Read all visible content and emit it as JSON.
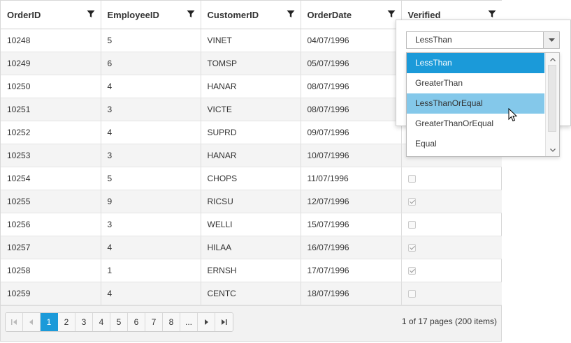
{
  "grid": {
    "columns": [
      {
        "label": "OrderID",
        "key": "order_id"
      },
      {
        "label": "EmployeeID",
        "key": "employee_id"
      },
      {
        "label": "CustomerID",
        "key": "customer_id"
      },
      {
        "label": "OrderDate",
        "key": "order_date"
      },
      {
        "label": "Verified",
        "key": "verified"
      }
    ],
    "rows": [
      {
        "order_id": "10248",
        "employee_id": "5",
        "customer_id": "VINET",
        "order_date": "04/07/1996",
        "verified": null
      },
      {
        "order_id": "10249",
        "employee_id": "6",
        "customer_id": "TOMSP",
        "order_date": "05/07/1996",
        "verified": null
      },
      {
        "order_id": "10250",
        "employee_id": "4",
        "customer_id": "HANAR",
        "order_date": "08/07/1996",
        "verified": null
      },
      {
        "order_id": "10251",
        "employee_id": "3",
        "customer_id": "VICTE",
        "order_date": "08/07/1996",
        "verified": null
      },
      {
        "order_id": "10252",
        "employee_id": "4",
        "customer_id": "SUPRD",
        "order_date": "09/07/1996",
        "verified": null
      },
      {
        "order_id": "10253",
        "employee_id": "3",
        "customer_id": "HANAR",
        "order_date": "10/07/1996",
        "verified": null
      },
      {
        "order_id": "10254",
        "employee_id": "5",
        "customer_id": "CHOPS",
        "order_date": "11/07/1996",
        "verified": false
      },
      {
        "order_id": "10255",
        "employee_id": "9",
        "customer_id": "RICSU",
        "order_date": "12/07/1996",
        "verified": true
      },
      {
        "order_id": "10256",
        "employee_id": "3",
        "customer_id": "WELLI",
        "order_date": "15/07/1996",
        "verified": false
      },
      {
        "order_id": "10257",
        "employee_id": "4",
        "customer_id": "HILAA",
        "order_date": "16/07/1996",
        "verified": true
      },
      {
        "order_id": "10258",
        "employee_id": "1",
        "customer_id": "ERNSH",
        "order_date": "17/07/1996",
        "verified": true
      },
      {
        "order_id": "10259",
        "employee_id": "4",
        "customer_id": "CENTC",
        "order_date": "18/07/1996",
        "verified": false
      }
    ]
  },
  "pager": {
    "pages": [
      "1",
      "2",
      "3",
      "4",
      "5",
      "6",
      "7",
      "8",
      "..."
    ],
    "current_page": "1",
    "info": "1 of 17 pages (200 items)"
  },
  "filter_popup": {
    "selected_value": "LessThan",
    "options": [
      "LessThan",
      "GreaterThan",
      "LessThanOrEqual",
      "GreaterThanOrEqual",
      "Equal"
    ],
    "selected_option": "LessThan",
    "hovered_option": "LessThanOrEqual"
  },
  "colors": {
    "accent": "#1b9ad9",
    "hover": "#84c8ea",
    "alt_row": "#f4f4f4"
  }
}
